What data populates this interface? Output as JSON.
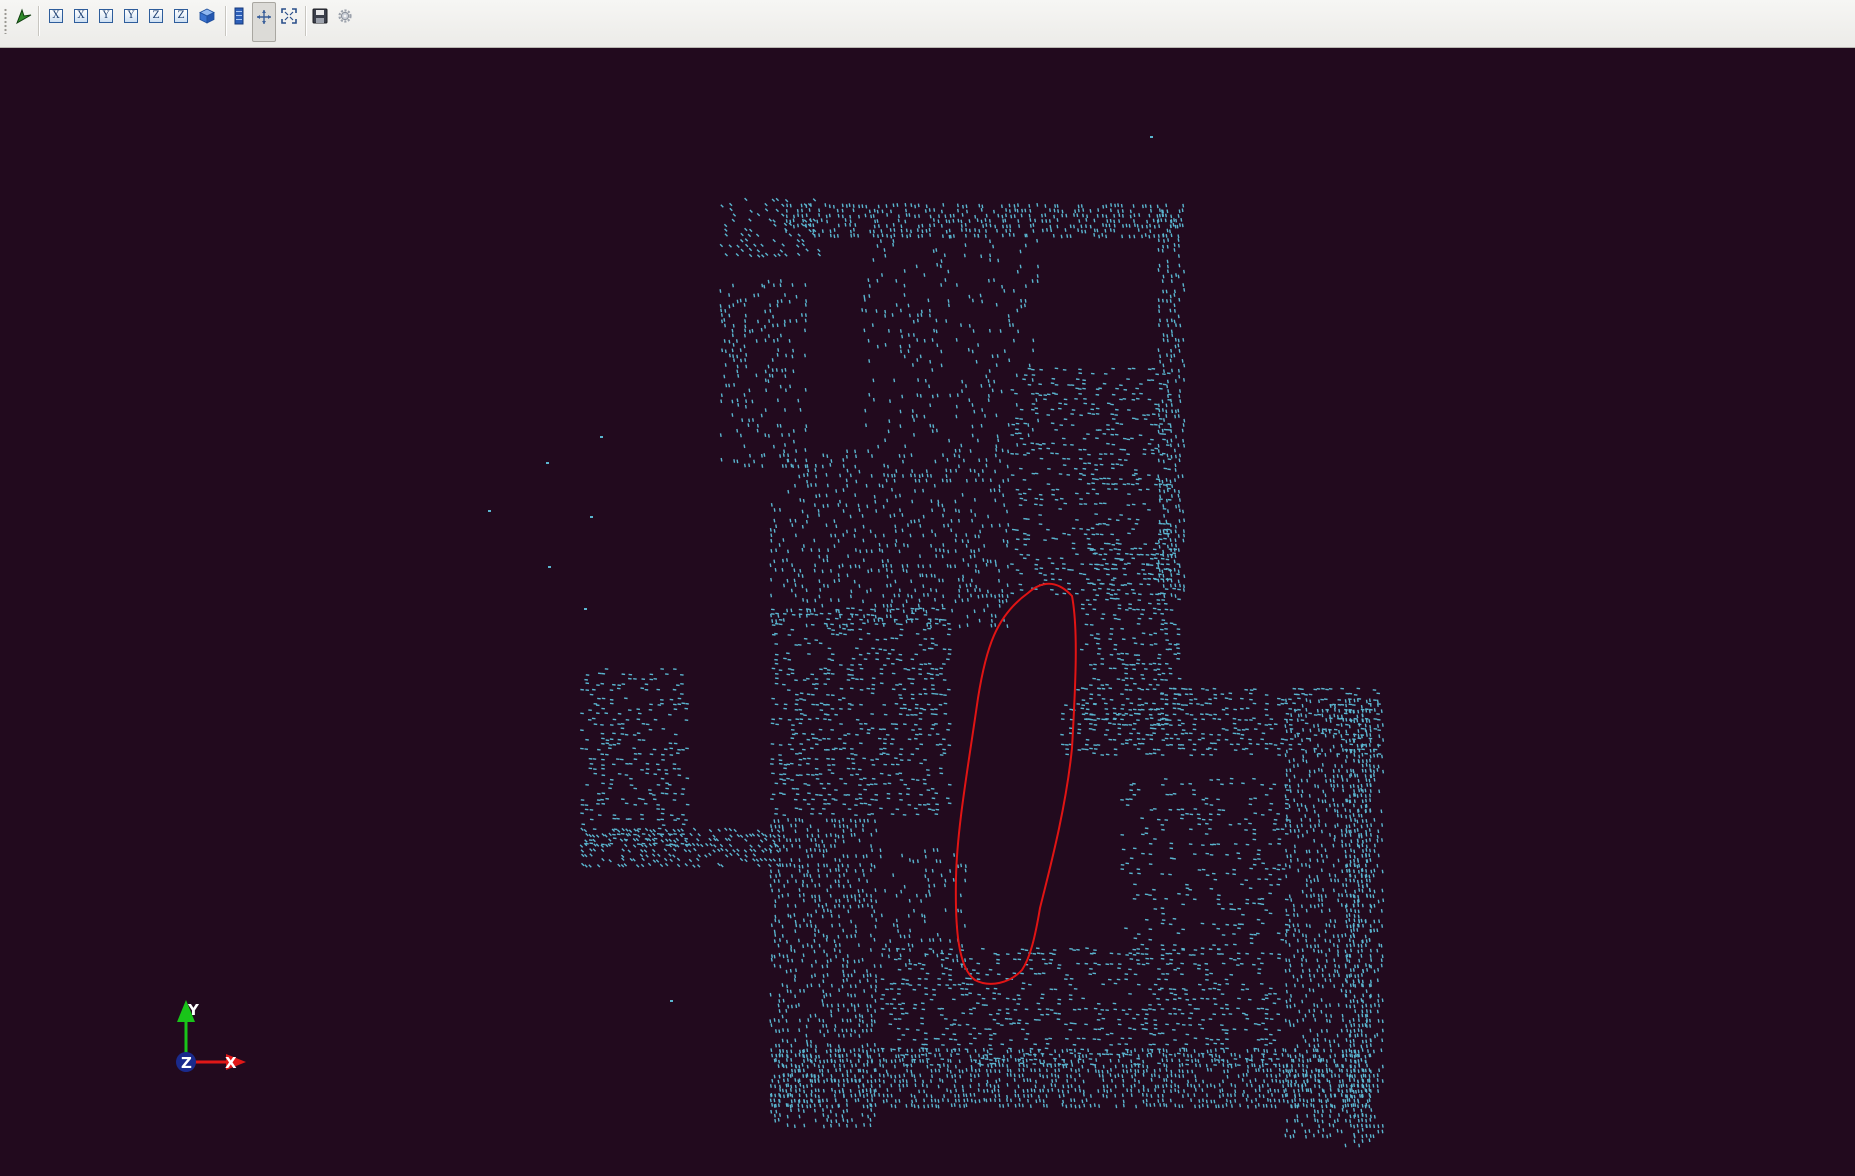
{
  "toolbar": {
    "buttons": [
      {
        "name": "pick-point-button",
        "icon": "pick-arrow-icon",
        "glyph": ""
      },
      {
        "name": "view-x-positive-button",
        "icon": "x-axis-icon",
        "glyph": "X"
      },
      {
        "name": "view-x-negative-button",
        "icon": "x-axis-icon",
        "glyph": "X"
      },
      {
        "name": "view-y-positive-button",
        "icon": "y-axis-icon",
        "glyph": "Y"
      },
      {
        "name": "view-y-negative-button",
        "icon": "y-axis-icon",
        "glyph": "Y"
      },
      {
        "name": "view-z-positive-button",
        "icon": "z-axis-icon",
        "glyph": "Z"
      },
      {
        "name": "view-z-negative-button",
        "icon": "z-axis-icon",
        "glyph": "Z"
      },
      {
        "name": "isometric-view-button",
        "icon": "cube-icon",
        "glyph": ""
      },
      {
        "name": "toggle-panel-button",
        "icon": "panel-icon",
        "glyph": ""
      },
      {
        "name": "rotate-mode-button",
        "icon": "rotate-cursor-icon",
        "glyph": "",
        "active": true
      },
      {
        "name": "fit-view-button",
        "icon": "fit-view-icon",
        "glyph": ""
      },
      {
        "name": "save-button",
        "icon": "save-icon",
        "glyph": ""
      },
      {
        "name": "settings-button",
        "icon": "gear-icon",
        "glyph": ""
      }
    ]
  },
  "viewport": {
    "background_color": "#220a1e",
    "point_color": "#5ab5cf",
    "annotation_color": "#e01414"
  },
  "axis_triad": {
    "y_label": "Y",
    "x_label": "X",
    "z_label": "Z",
    "y_color": "#19c419",
    "x_color": "#e01818",
    "z_color": "#1a2a8c"
  }
}
